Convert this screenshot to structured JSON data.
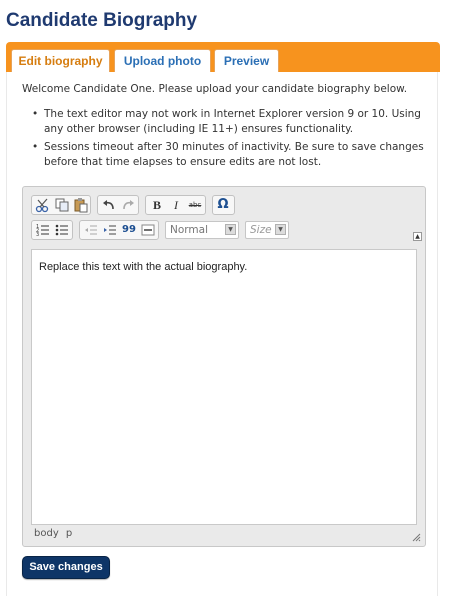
{
  "page": {
    "title": "Candidate Biography"
  },
  "tabs": [
    {
      "label": "Edit biography",
      "active": true
    },
    {
      "label": "Upload photo",
      "active": false
    },
    {
      "label": "Preview",
      "active": false
    }
  ],
  "intro": {
    "welcome": "Welcome Candidate One. Please upload your candidate biography below.",
    "notes": [
      "The text editor may not work in Internet Explorer version 9 or 10. Using any other browser (including IE 11+) ensures functionality.",
      "Sessions timeout after 30 minutes of inactivity. Be sure to save changes before that time elapses to ensure edits are not lost."
    ]
  },
  "editor": {
    "toolbar": {
      "row1": [
        "cut-icon",
        "copy-icon",
        "paste-icon",
        "undo-icon",
        "redo-icon",
        "bold-icon",
        "italic-icon",
        "strikethrough-icon",
        "special-char-icon"
      ],
      "row2": [
        "numbered-list-icon",
        "bulleted-list-icon",
        "outdent-icon",
        "indent-icon",
        "blockquote-icon",
        "horizontal-rule-icon"
      ],
      "format_value": "Normal",
      "size_placeholder": "Size",
      "labels": {
        "bold": "B",
        "italic": "I",
        "strike": "abc",
        "omega": "Ω",
        "quote": "99"
      }
    },
    "content": "Replace this text with the actual biography.",
    "status_path": "body  p"
  },
  "actions": {
    "save_label": "Save changes"
  },
  "colors": {
    "title": "#1f3a70",
    "tabbar": "#f7931e",
    "active_tab_text": "#d67d10",
    "link_tab_text": "#2b6fb5",
    "save_button": "#0e3567"
  }
}
